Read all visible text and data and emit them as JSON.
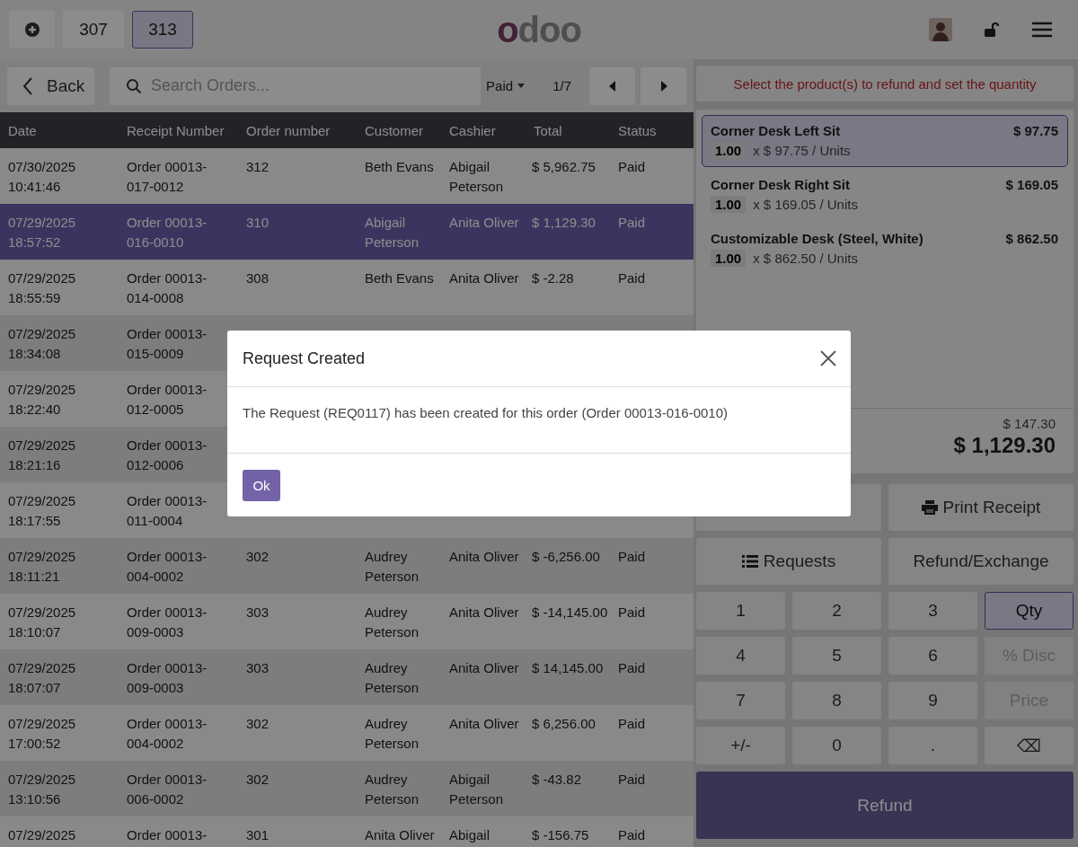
{
  "top_bar": {
    "sessions": [
      {
        "kind": "new",
        "selected": false
      },
      {
        "kind": "order",
        "label": "307",
        "selected": false
      },
      {
        "kind": "order",
        "label": "313",
        "selected": true
      }
    ],
    "logo": "odoo"
  },
  "toolbar": {
    "back": "Back",
    "search": {
      "placeholder": "Search Orders..."
    },
    "filter": "Paid",
    "pager": "1/7"
  },
  "table": {
    "columns": [
      "Date",
      "Receipt Number",
      "Order number",
      "Customer",
      "Cashier",
      "Total",
      "Status"
    ],
    "rows": [
      {
        "selected": false,
        "cells": [
          "07/30/2025 10:41:46",
          "Order 00013-017-0012",
          "312",
          "Beth Evans",
          "Abigail Peterson",
          "$ 5,962.75",
          "Paid"
        ]
      },
      {
        "selected": true,
        "cells": [
          "07/29/2025 18:57:52",
          "Order 00013-016-0010",
          "310",
          "Abigail Peterson",
          "Anita Oliver",
          "$ 1,129.30",
          "Paid"
        ]
      },
      {
        "selected": false,
        "cells": [
          "07/29/2025 18:55:59",
          "Order 00013-014-0008",
          "308",
          "Beth Evans",
          "Anita Oliver",
          "$ -2.28",
          "Paid"
        ]
      },
      {
        "selected": false,
        "cells": [
          "07/29/2025 18:34:08",
          "Order 00013-015-0009"
        ]
      },
      {
        "selected": false,
        "cells": [
          "07/29/2025 18:22:40",
          "Order 00013-012-0005"
        ]
      },
      {
        "selected": false,
        "cells": [
          "07/29/2025 18:21:16",
          "Order 00013-012-0006"
        ]
      },
      {
        "selected": false,
        "cells": [
          "07/29/2025 18:17:55",
          "Order 00013-011-0004"
        ]
      },
      {
        "selected": false,
        "cells": [
          "07/29/2025 18:11:21",
          "Order 00013-004-0002",
          "302",
          "Audrey Peterson",
          "Anita Oliver",
          "$ -6,256.00",
          "Paid"
        ]
      },
      {
        "selected": false,
        "cells": [
          "07/29/2025 18:10:07",
          "Order 00013-009-0003",
          "303",
          "Audrey Peterson",
          "Anita Oliver",
          "$ -14,145.00",
          "Paid"
        ]
      },
      {
        "selected": false,
        "cells": [
          "07/29/2025 18:07:07",
          "Order 00013-009-0003",
          "303",
          "Audrey Peterson",
          "Anita Oliver",
          "$ 14,145.00",
          "Paid"
        ]
      },
      {
        "selected": false,
        "cells": [
          "07/29/2025 17:00:52",
          "Order 00013-004-0002",
          "302",
          "Audrey Peterson",
          "Anita Oliver",
          "$ 6,256.00",
          "Paid"
        ]
      },
      {
        "selected": false,
        "cells": [
          "07/29/2025 13:10:56",
          "Order 00013-006-0002",
          "302",
          "Audrey Peterson",
          "Abigail Peterson",
          "$ -43.82",
          "Paid"
        ]
      },
      {
        "selected": false,
        "cells": [
          "07/29/2025",
          "Order 00013-",
          "301",
          "Anita Oliver",
          "Abigail",
          "$ -156.75",
          "Paid"
        ]
      }
    ]
  },
  "refund": {
    "message": "Select the product(s) to refund and set the quantity",
    "lines": [
      {
        "name": "Corner Desk Left Sit",
        "price": "$ 97.75",
        "qty": "1.00",
        "unit": "x $ 97.75 / Units",
        "selected": true
      },
      {
        "name": "Corner Desk Right Sit",
        "price": "$ 169.05",
        "qty": "1.00",
        "unit": "x $ 169.05 / Units",
        "selected": false
      },
      {
        "name": "Customizable Desk (Steel, White)",
        "price": "$ 862.50",
        "qty": "1.00",
        "unit": "x $ 862.50 / Units",
        "selected": false
      }
    ],
    "taxes": "$ 147.30",
    "total": "$ 1,129.30",
    "actions": [
      {
        "kind": "blank"
      },
      {
        "kind": "print",
        "label": "Print Receipt"
      },
      {
        "kind": "list",
        "label": "Requests"
      },
      {
        "kind": "plain",
        "label": "Refund/Exchange"
      }
    ],
    "numpad": [
      {
        "label": "1",
        "selected": false,
        "disabled": false
      },
      {
        "label": "2",
        "selected": false,
        "disabled": false
      },
      {
        "label": "3",
        "selected": false,
        "disabled": false
      },
      {
        "label": "Qty",
        "selected": true,
        "disabled": false
      },
      {
        "label": "4",
        "selected": false,
        "disabled": false
      },
      {
        "label": "5",
        "selected": false,
        "disabled": false
      },
      {
        "label": "6",
        "selected": false,
        "disabled": false
      },
      {
        "label": "% Disc",
        "selected": false,
        "disabled": true
      },
      {
        "label": "7",
        "selected": false,
        "disabled": false
      },
      {
        "label": "8",
        "selected": false,
        "disabled": false
      },
      {
        "label": "9",
        "selected": false,
        "disabled": false
      },
      {
        "label": "Price",
        "selected": false,
        "disabled": true
      },
      {
        "label": "+/-",
        "selected": false,
        "disabled": false
      },
      {
        "label": "0",
        "selected": false,
        "disabled": false
      },
      {
        "label": ".",
        "selected": false,
        "disabled": false
      },
      {
        "label": "⌫",
        "selected": false,
        "disabled": false
      }
    ],
    "refund_button": "Refund"
  },
  "dialog": {
    "title": "Request Created",
    "message": "The Request (REQ0117) has been created for this order (Order 00013-016-0010)",
    "ok": "Ok"
  }
}
